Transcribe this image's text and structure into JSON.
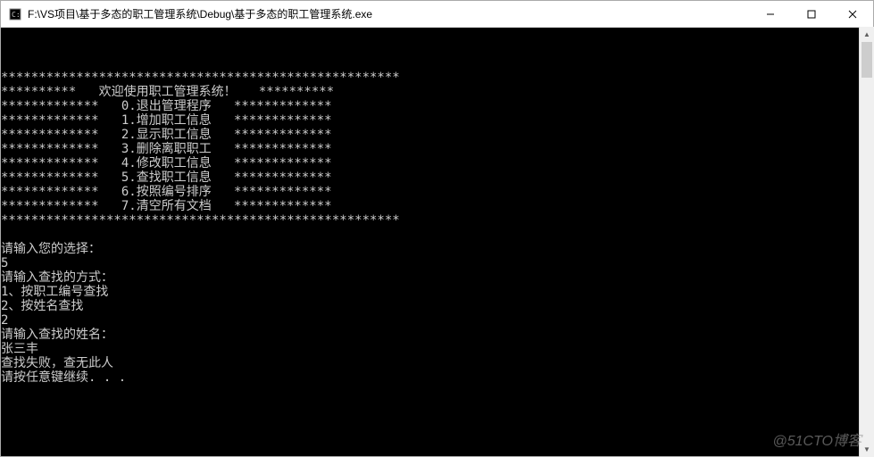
{
  "titlebar": {
    "path": "F:\\VS项目\\基于多态的职工管理系统\\Debug\\基于多态的职工管理系统.exe"
  },
  "menu": {
    "border_top": "*****************************************************",
    "welcome": "**********   欢迎使用职工管理系统！   **********",
    "items": [
      "*************   0.退出管理程序   *************",
      "*************   1.增加职工信息   *************",
      "*************   2.显示职工信息   *************",
      "*************   3.删除离职职工   *************",
      "*************   4.修改职工信息   *************",
      "*************   5.查找职工信息   *************",
      "*************   6.按照编号排序   *************",
      "*************   7.清空所有文档   *************"
    ],
    "border_bottom": "*****************************************************"
  },
  "session": {
    "prompt_choice": "请输入您的选择：",
    "choice_input": "5",
    "prompt_method": "请输入查找的方式：",
    "method_option1": "1、按职工编号查找",
    "method_option2": "2、按姓名查找",
    "method_input": "2",
    "prompt_name": "请输入查找的姓名：",
    "name_input": "张三丰",
    "result": "查找失败，查无此人",
    "continue": "请按任意键继续. . ."
  },
  "watermark": "@51CTO博客"
}
